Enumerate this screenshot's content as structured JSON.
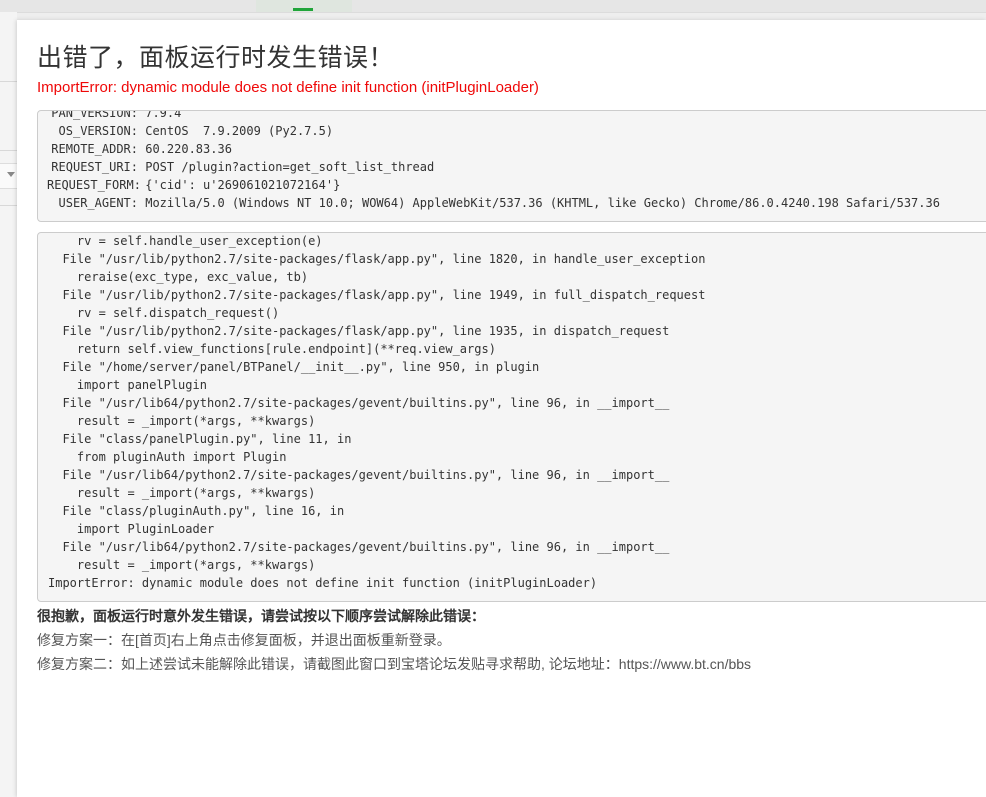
{
  "modal": {
    "title": "出错了，面板运行时发生错误！",
    "error_message": "ImportError: dynamic module does not define init function (initPluginLoader)"
  },
  "request_info": [
    {
      "key": "PAN_VERSION:",
      "value": "7.9.4"
    },
    {
      "key": "OS_VERSION:",
      "value": "CentOS  7.9.2009 (Py2.7.5)"
    },
    {
      "key": "REMOTE_ADDR:",
      "value": "60.220.83.36"
    },
    {
      "key": "REQUEST_URI:",
      "value": "POST /plugin?action=get_soft_list_thread"
    },
    {
      "key": "REQUEST_FORM:",
      "value": "{'cid': u'269061021072164'}"
    },
    {
      "key": "USER_AGENT:",
      "value": "Mozilla/5.0 (Windows NT 10.0; WOW64) AppleWebKit/537.36 (KHTML, like Gecko) Chrome/86.0.4240.198 Safari/537.36"
    }
  ],
  "traceback": [
    "    rv = self.handle_user_exception(e)",
    "  File \"/usr/lib/python2.7/site-packages/flask/app.py\", line 1820, in handle_user_exception",
    "    reraise(exc_type, exc_value, tb)",
    "  File \"/usr/lib/python2.7/site-packages/flask/app.py\", line 1949, in full_dispatch_request",
    "    rv = self.dispatch_request()",
    "  File \"/usr/lib/python2.7/site-packages/flask/app.py\", line 1935, in dispatch_request",
    "    return self.view_functions[rule.endpoint](**req.view_args)",
    "  File \"/home/server/panel/BTPanel/__init__.py\", line 950, in plugin",
    "    import panelPlugin",
    "  File \"/usr/lib64/python2.7/site-packages/gevent/builtins.py\", line 96, in __import__",
    "    result = _import(*args, **kwargs)",
    "  File \"class/panelPlugin.py\", line 11, in",
    "    from pluginAuth import Plugin",
    "  File \"/usr/lib64/python2.7/site-packages/gevent/builtins.py\", line 96, in __import__",
    "    result = _import(*args, **kwargs)",
    "  File \"class/pluginAuth.py\", line 16, in",
    "    import PluginLoader",
    "  File \"/usr/lib64/python2.7/site-packages/gevent/builtins.py\", line 96, in __import__",
    "    result = _import(*args, **kwargs)",
    "ImportError: dynamic module does not define init function (initPluginLoader)"
  ],
  "notes": {
    "heading": "很抱歉，面板运行时意外发生错误，请尝试按以下顺序尝试解除此错误：",
    "fix1": "修复方案一：在[首页]右上角点击修复面板，并退出面板重新登录。",
    "fix2": "修复方案二：如上述尝试未能解除此错误，请截图此窗口到宝塔论坛发贴寻求帮助, 论坛地址：https://www.bt.cn/bbs"
  },
  "colors": {
    "error": "#ef0808",
    "accent": "#20a53a"
  }
}
